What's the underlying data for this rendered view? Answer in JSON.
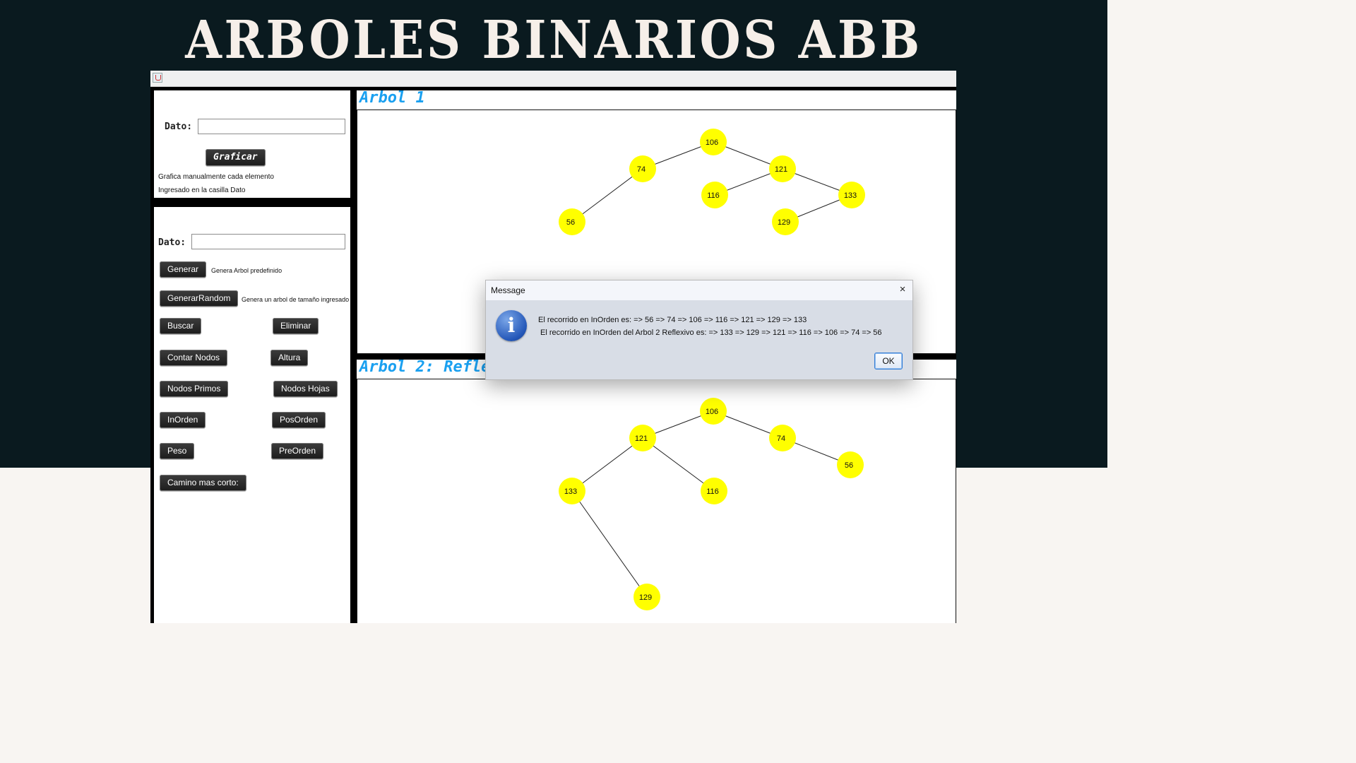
{
  "banner": {
    "title": "Arboles Binarios ABB"
  },
  "manual_panel": {
    "dato_label": "Dato:",
    "dato_value": "",
    "graficar_label": "Graficar",
    "note_line1": "Grafica manualmente cada elemento",
    "note_line2": "Ingresado en la casilla Dato"
  },
  "ops_panel": {
    "dato_label": "Dato:",
    "dato_value": "",
    "generar_label": "Generar",
    "generar_note": "Genera Arbol predefinido",
    "generar_random_label": "GenerarRandom",
    "generar_random_note": "Genera un arbol de tamaño ingresado",
    "buscar_label": "Buscar",
    "eliminar_label": "Eliminar",
    "contar_nodos_label": "Contar Nodos",
    "altura_label": "Altura",
    "nodos_primos_label": "Nodos Primos",
    "nodos_hojas_label": "Nodos Hojas",
    "inorden_label": "InOrden",
    "posorden_label": "PosOrden",
    "peso_label": "Peso",
    "preorden_label": "PreOrden",
    "camino_label": "Camino mas corto:"
  },
  "tree1": {
    "title": "Arbol 1",
    "nodes": [
      {
        "id": "n106",
        "label": "106"
      },
      {
        "id": "n74",
        "label": "74"
      },
      {
        "id": "n121",
        "label": "121"
      },
      {
        "id": "n56",
        "label": "56"
      },
      {
        "id": "n116",
        "label": "116"
      },
      {
        "id": "n133",
        "label": "133"
      },
      {
        "id": "n129",
        "label": "129"
      }
    ],
    "edges": [
      [
        "n106",
        "n74"
      ],
      [
        "n106",
        "n121"
      ],
      [
        "n74",
        "n56"
      ],
      [
        "n121",
        "n116"
      ],
      [
        "n121",
        "n133"
      ],
      [
        "n133",
        "n129"
      ]
    ]
  },
  "tree2": {
    "title": "Arbol 2: Refle",
    "nodes": [
      {
        "id": "m106",
        "label": "106"
      },
      {
        "id": "m121",
        "label": "121"
      },
      {
        "id": "m74",
        "label": "74"
      },
      {
        "id": "m56",
        "label": "56"
      },
      {
        "id": "m133",
        "label": "133"
      },
      {
        "id": "m116",
        "label": "116"
      },
      {
        "id": "m129",
        "label": "129"
      }
    ],
    "edges": [
      [
        "m106",
        "m121"
      ],
      [
        "m106",
        "m74"
      ],
      [
        "m74",
        "m56"
      ],
      [
        "m121",
        "m133"
      ],
      [
        "m121",
        "m116"
      ],
      [
        "m133",
        "m129"
      ]
    ]
  },
  "node_color": "#ffff00",
  "title_color": "#1aa0f0",
  "dialog": {
    "title": "Message",
    "close_icon": "×",
    "info_icon": "i",
    "line1": "El recorrido en InOrden es:  => 56 => 74 => 106 => 116 => 121 => 129 => 133",
    "line2": "El recorrido en InOrden del Arbol 2 Reflexivo es:  => 133 => 129 => 121 => 116 => 106 => 74 => 56",
    "ok_label": "OK"
  }
}
